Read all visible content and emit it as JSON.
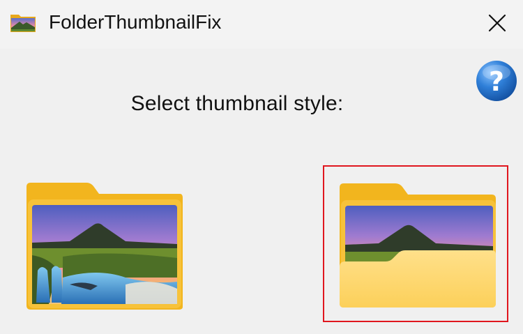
{
  "window": {
    "title": "FolderThumbnailFix",
    "icons": {
      "app": "folder-image-icon",
      "close": "close-icon",
      "help": "help-icon"
    }
  },
  "main": {
    "prompt": "Select thumbnail style:",
    "options": [
      {
        "id": "full-image-folder",
        "selected": false
      },
      {
        "id": "image-behind-front-flap",
        "selected": true
      }
    ]
  },
  "colors": {
    "selection_border": "#e0161e",
    "folder_yellow": "#f7c23a",
    "help_blue": "#1e72c8"
  }
}
